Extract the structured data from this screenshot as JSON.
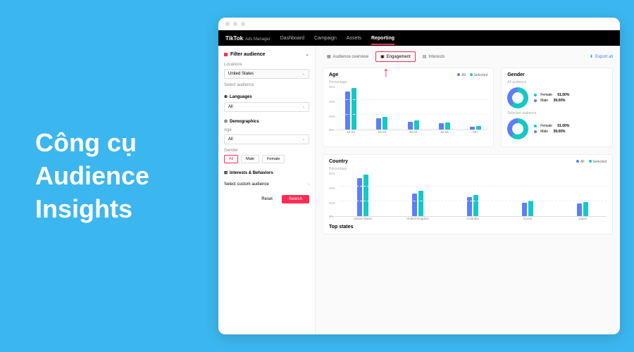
{
  "left_title": "Công cụ\nAudience\nInsights",
  "brand": "TikTok",
  "brand_sub": ": Ads Manager",
  "nav": [
    "Dashboard",
    "Campaign",
    "Assets",
    "Reporting"
  ],
  "nav_active": 3,
  "export_label": "Export all",
  "tabs": {
    "overview": "Audience overview",
    "engagement": "Engagement",
    "interests": "Interests"
  },
  "sidebar": {
    "filter_title": "Filter audience",
    "locations_label": "Locations",
    "locations_value": "United States",
    "select_audience_label": "Select audience",
    "languages_label": "Languages",
    "languages_value": "All",
    "demographics_label": "Demographics",
    "age_label": "Age",
    "age_value": "All",
    "gender_label": "Gender",
    "gender_options": [
      "All",
      "Male",
      "Female"
    ],
    "interests_label": "Interests & Behaviors",
    "custom_label": "Select custom audience",
    "reset": "Reset",
    "search": "Search"
  },
  "legend": {
    "all": "All",
    "selected": "Selected"
  },
  "age_card": {
    "title": "Age",
    "ylabel": "Percentage"
  },
  "gender_card": {
    "title": "Gender",
    "all_label": "All audience",
    "sel_label": "Selected audience",
    "female": "Female",
    "female_pct": "61.00%",
    "male": "Male",
    "male_pct": "39.00%"
  },
  "country_card": {
    "title": "Country",
    "ylabel": "Percentage"
  },
  "top_states": "Top states",
  "chart_data": [
    {
      "type": "bar",
      "title": "Age",
      "ylabel": "Percentage",
      "ylim": [
        0,
        60
      ],
      "categories": [
        "18-24",
        "25-34",
        "35-44",
        "45-54",
        "55+"
      ],
      "series": [
        {
          "name": "All",
          "values": [
            50,
            15,
            10,
            8,
            4
          ]
        },
        {
          "name": "Selected",
          "values": [
            55,
            17,
            12,
            9,
            5
          ]
        }
      ]
    },
    {
      "type": "pie",
      "title": "Gender — All audience",
      "series": [
        {
          "name": "Female",
          "value": 61.0
        },
        {
          "name": "Male",
          "value": 39.0
        }
      ]
    },
    {
      "type": "pie",
      "title": "Gender — Selected audience",
      "series": [
        {
          "name": "Female",
          "value": 61.0
        },
        {
          "name": "Male",
          "value": 39.0
        }
      ]
    },
    {
      "type": "bar",
      "title": "Country",
      "ylabel": "Percentage",
      "ylim": [
        0,
        60
      ],
      "categories": [
        "United States",
        "United Kingdom",
        "Australia",
        "Korea",
        "Japan"
      ],
      "series": [
        {
          "name": "All",
          "values": [
            50,
            30,
            25,
            18,
            17
          ]
        },
        {
          "name": "Selected",
          "values": [
            55,
            33,
            28,
            20,
            19
          ]
        }
      ]
    }
  ]
}
